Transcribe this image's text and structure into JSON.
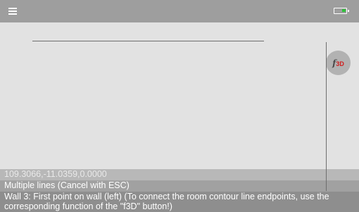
{
  "topbar": {
    "menu_icon": "hamburger-menu-icon",
    "battery_icon": "battery-icon",
    "battery_color": "#2fbf3a"
  },
  "f3d_button": {
    "icon": "f3d-icon",
    "f_text": "f",
    "three_d_text": "3D"
  },
  "status": {
    "coordinates": "109.3066,-11.0359,0.0000",
    "mode": "Multiple lines (Cancel with ESC)",
    "prompt": "Wall 3: First point on wall (left) (To connect the room contour line endpoints, use the corresponding function of the \"f3D\" button!)"
  }
}
